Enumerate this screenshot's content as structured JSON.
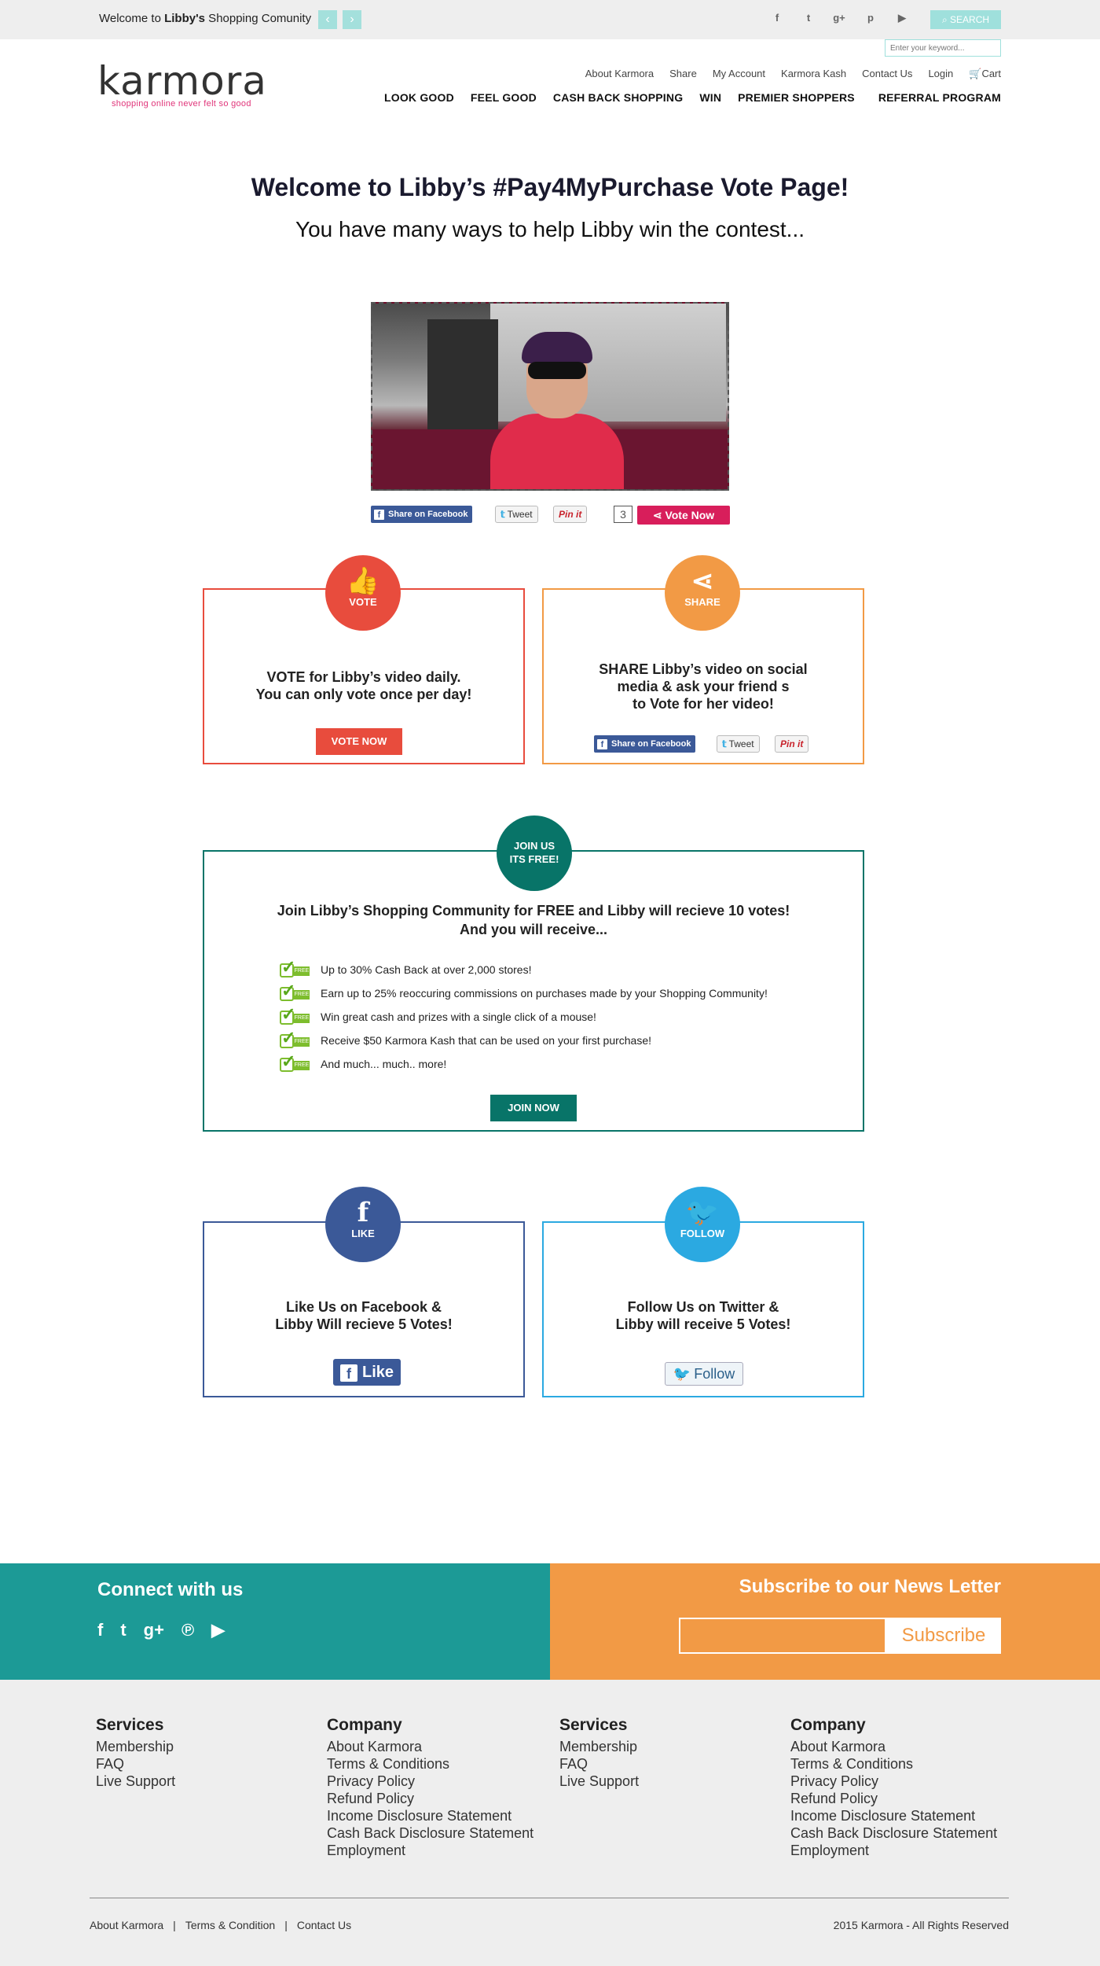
{
  "topbar": {
    "welcome_prefix": "Welcome to ",
    "welcome_name": "Libby's",
    "welcome_suffix": " Shopping Comunity",
    "prev_arrow": "‹",
    "next_arrow": "›",
    "social_icons": [
      "facebook-icon",
      "twitter-icon",
      "google-plus-icon",
      "pinterest-icon",
      "youtube-icon"
    ],
    "search_label": "SEARCH",
    "search_placeholder": "Enter your keyword..."
  },
  "header": {
    "logo_text": "karmora",
    "logo_tagline": "shopping online never felt so good",
    "util_nav": [
      "About Karmora",
      "Share",
      "My Account",
      "Karmora Kash",
      "Contact Us",
      "Login",
      "Cart"
    ],
    "main_nav": [
      "LOOK GOOD",
      "FEEL GOOD",
      "CASH BACK SHOPPING",
      "WIN",
      "PREMIER SHOPPERS",
      "REFERRAL PROGRAM"
    ]
  },
  "hero": {
    "title": "Welcome to Libby’s #Pay4MyPurchase Vote Page!",
    "subtitle": "You have many ways to help Libby win the contest..."
  },
  "share_bar": {
    "facebook": "Share on Facebook",
    "tweet": "Tweet",
    "pin": "Pin it",
    "vote_count": "3",
    "vote_now": "Vote Now"
  },
  "vote_card": {
    "badge": "VOTE",
    "line1": "VOTE for Libby’s video daily.",
    "line2": "You can only vote once per day!",
    "button": "VOTE NOW"
  },
  "share_card": {
    "badge": "SHARE",
    "line1": "SHARE Libby’s video on social",
    "line2": "media & ask your friend s",
    "line3": "to Vote for her video!",
    "facebook": "Share on Facebook",
    "tweet": "Tweet",
    "pin": "Pin it"
  },
  "join_card": {
    "badge_line1": "JOIN US",
    "badge_line2": "ITS FREE!",
    "line1": "Join Libby’s Shopping Community for FREE and Libby will recieve 10 votes!",
    "line2": "And you will receive...",
    "benefits": [
      "Up to 30% Cash Back at over 2,000 stores!",
      "Earn up to 25% reoccuring commissions on purchases made by your Shopping Community!",
      "Win great cash and prizes with a single click of a mouse!",
      "Receive $50 Karmora Kash that can be used on your first purchase!",
      "And much... much.. more!"
    ],
    "button": "JOIN NOW"
  },
  "like_card": {
    "badge": "LIKE",
    "line1": "Like Us on Facebook &",
    "line2": "Libby Will recieve 5 Votes!",
    "button": "Like"
  },
  "follow_card": {
    "badge": "FOLLOW",
    "line1": "Follow Us on Twitter &",
    "line2": "Libby will receive 5 Votes!",
    "button": "Follow"
  },
  "footer": {
    "connect_title": "Connect with us",
    "subscribe_title": "Subscribe to our News Letter",
    "subscribe_button": "Subscribe",
    "columns": [
      {
        "title": "Services",
        "links": [
          "Membership",
          "FAQ",
          "Live Support"
        ]
      },
      {
        "title": "Company",
        "links": [
          "About Karmora",
          "Terms & Conditions",
          "Privacy Policy",
          "Refund Policy",
          "Income Disclosure Statement",
          "Cash Back Disclosure Statement",
          "Employment"
        ]
      },
      {
        "title": "Services",
        "links": [
          "Membership",
          "FAQ",
          "Live Support"
        ]
      },
      {
        "title": "Company",
        "links": [
          "About Karmora",
          "Terms & Conditions",
          "Privacy Policy",
          "Refund Policy",
          "Income Disclosure Statement",
          "Cash Back Disclosure Statement",
          "Employment"
        ]
      }
    ],
    "bottom_links": [
      "About Karmora",
      "Terms & Condition",
      "Contact Us"
    ],
    "separator": "|",
    "copyright": "2015 Karmora - All Rights Reserved"
  },
  "colors": {
    "teal": "#1c9a96",
    "orange": "#f29a45",
    "red": "#e84c3d",
    "dark_teal": "#087468",
    "facebook_blue": "#3b5998",
    "twitter_blue": "#2ba9e1",
    "pink": "#d81e5b"
  }
}
